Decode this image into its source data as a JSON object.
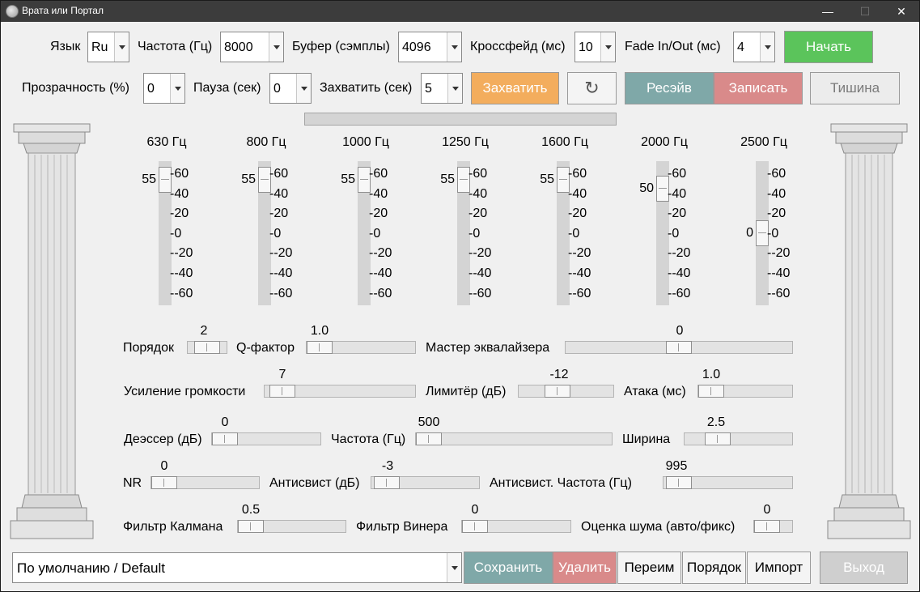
{
  "window": {
    "title": "Врата или Портал",
    "minimize": "—",
    "maximize": "☐",
    "close": "✕"
  },
  "row1": {
    "lang_label": "Язык",
    "lang_value": "Ru",
    "freq_label": "Частота (Гц)",
    "freq_value": "8000",
    "buffer_label": "Буфер (сэмплы)",
    "buffer_value": "4096",
    "crossfade_label": "Кроссфейд (мс)",
    "crossfade_value": "10",
    "fade_label": "Fade In/Out (мс)",
    "fade_value": "4",
    "start_button": "Начать"
  },
  "row2": {
    "transparency_label": "Прозрачность (%)",
    "transparency_value": "0",
    "pause_label": "Пауза (сек)",
    "pause_value": "0",
    "capture_label": "Захватить (сек)",
    "capture_value": "5",
    "capture_button": "Захватить",
    "refresh_icon": "↻",
    "receive_button": "Ресэйв",
    "record_button": "Записать",
    "silence_button": "Тишина"
  },
  "equalizer": {
    "bands": [
      {
        "label": "630 Гц",
        "value": "55",
        "level": 0.95
      },
      {
        "label": "800 Гц",
        "value": "55",
        "level": 0.95
      },
      {
        "label": "1000 Гц",
        "value": "55",
        "level": 0.95
      },
      {
        "label": "1250 Гц",
        "value": "55",
        "level": 0.95
      },
      {
        "label": "1600 Гц",
        "value": "55",
        "level": 0.95
      },
      {
        "label": "2000 Гц",
        "value": "50",
        "level": 0.88
      },
      {
        "label": "2500 Гц",
        "value": "0",
        "level": 0.5
      }
    ],
    "ticks": [
      "-60",
      "-40",
      "-20",
      "-0",
      "--20",
      "--40",
      "--60"
    ]
  },
  "controls": {
    "order_label": "Порядок",
    "order_value": "2",
    "q_label": "Q-фактор",
    "q_value": "1.0",
    "master_label": "Мастер эквалайзера",
    "master_value": "0",
    "gain_label": "Усиление громкости",
    "gain_value": "7",
    "limiter_label": "Лимитёр (дБ)",
    "limiter_value": "-12",
    "attack_label": "Атака (мс)",
    "attack_value": "1.0",
    "deesser_label": "Деэссер (дБ)",
    "deesser_value": "0",
    "deesser_freq_label": "Частота (Гц)",
    "deesser_freq_value": "500",
    "width_label": "Ширина",
    "width_value": "2.5",
    "nr_label": "NR",
    "nr_value": "0",
    "antiwhistle_label": "Антисвист (дБ)",
    "antiwhistle_value": "-3",
    "antiwhistle_freq_label": "Антисвист. Частота (Гц)",
    "antiwhistle_freq_value": "995",
    "kalman_label": "Фильтр Калмана",
    "kalman_value": "0.5",
    "wiener_label": "Фильтр Винера",
    "wiener_value": "0",
    "noise_label": "Оценка шума (авто/фикс)",
    "noise_value": "0"
  },
  "bottom": {
    "preset_value": "По умолчанию / Default",
    "save_button": "Сохранить",
    "delete_button": "Удалить",
    "rename_button": "Переим",
    "order_button": "Порядок",
    "import_button": "Импорт",
    "exit_button": "Выход"
  }
}
